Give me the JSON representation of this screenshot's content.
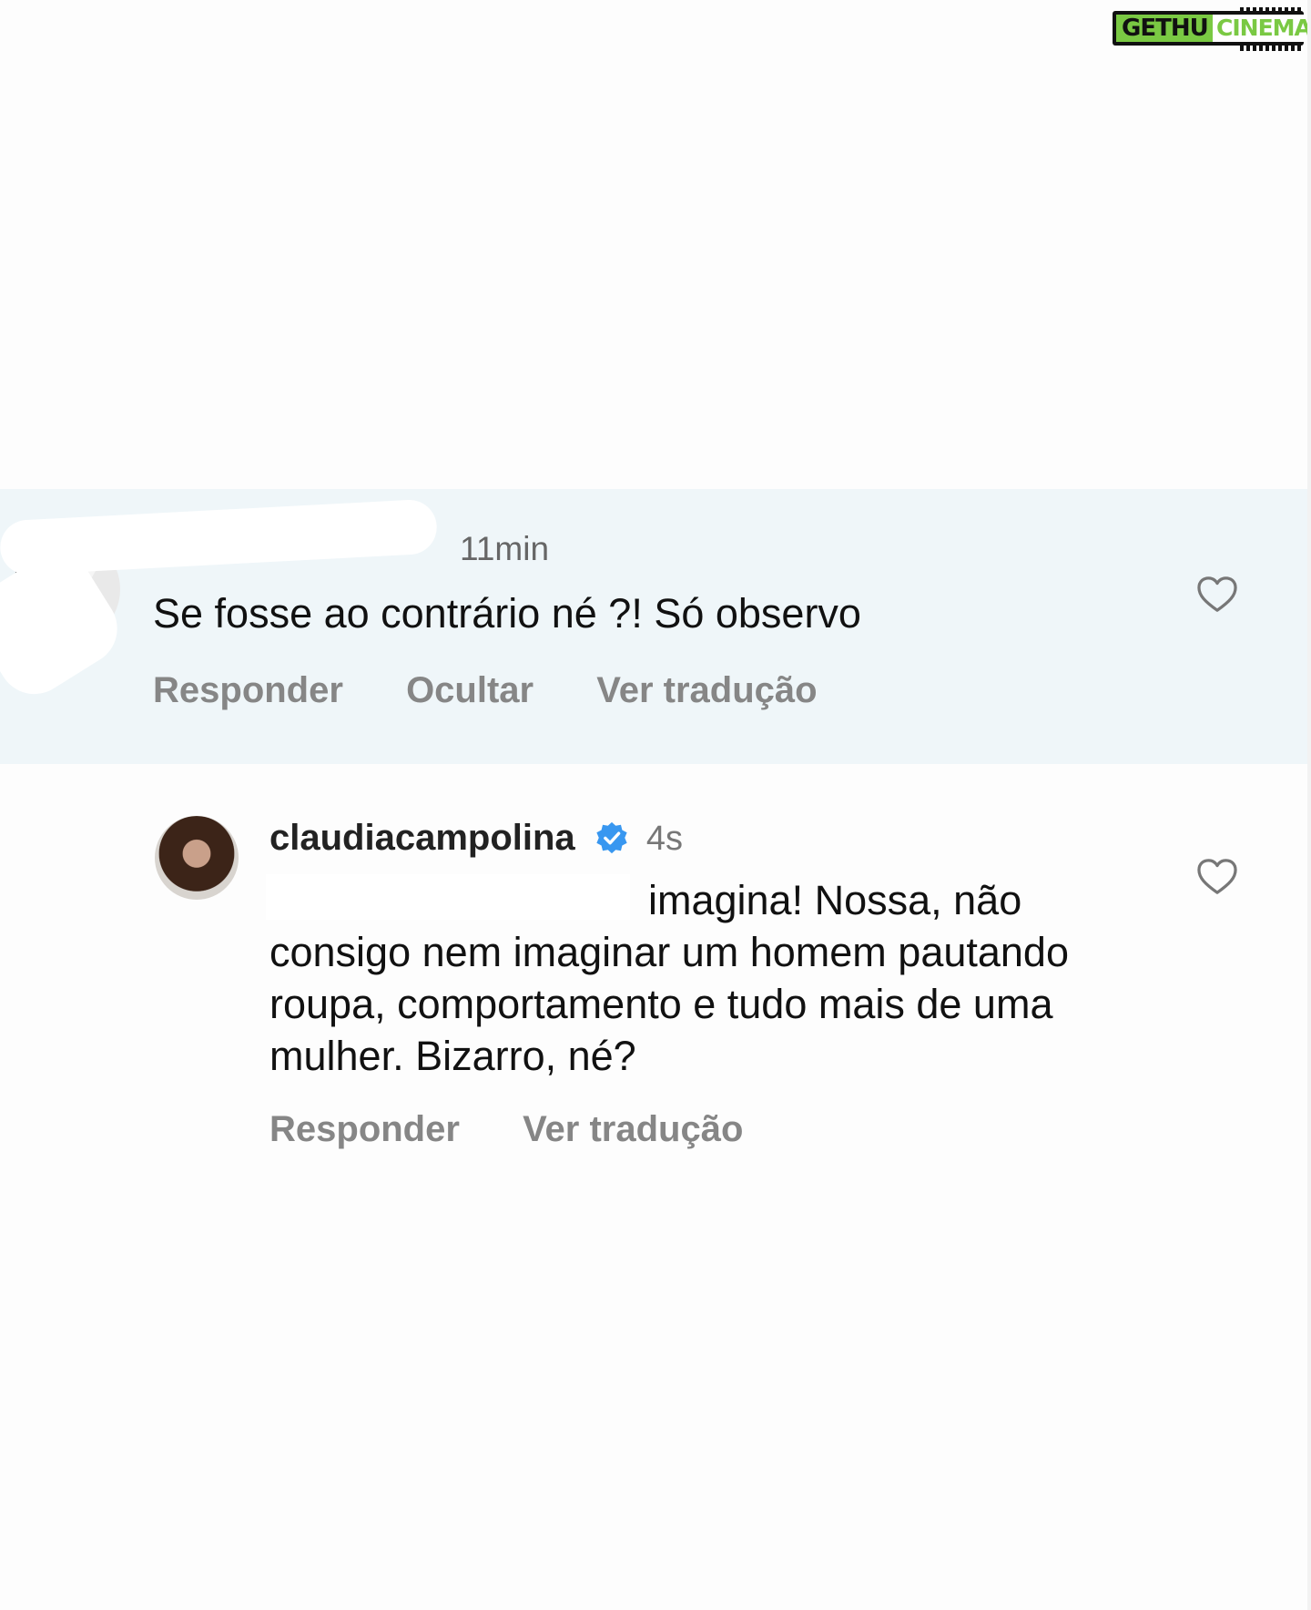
{
  "watermark": {
    "part1": "GETHU",
    "part2": "CINEMA"
  },
  "comment1": {
    "time": "11min",
    "text": "Se fosse ao contrário né ?! Só observo",
    "actions": {
      "reply": "Responder",
      "hide": "Ocultar",
      "translate": "Ver tradução"
    },
    "icons": {
      "like": "heart-outline-icon"
    }
  },
  "comment2": {
    "username": "claudiacampolina",
    "verified": true,
    "time": "4s",
    "text": "imagina! Nossa, não consigo nem imaginar um homem pautando roupa, comportamento e tudo mais de uma mulher. Bizarro, né?",
    "actions": {
      "reply": "Responder",
      "translate": "Ver tradução"
    },
    "icons": {
      "like": "heart-outline-icon",
      "badge": "verified-badge-icon"
    }
  },
  "colors": {
    "highlight_bg": "#eff6f9",
    "verified_blue": "#3897f0",
    "action_gray": "#868686",
    "logo_green": "#7ac943"
  }
}
